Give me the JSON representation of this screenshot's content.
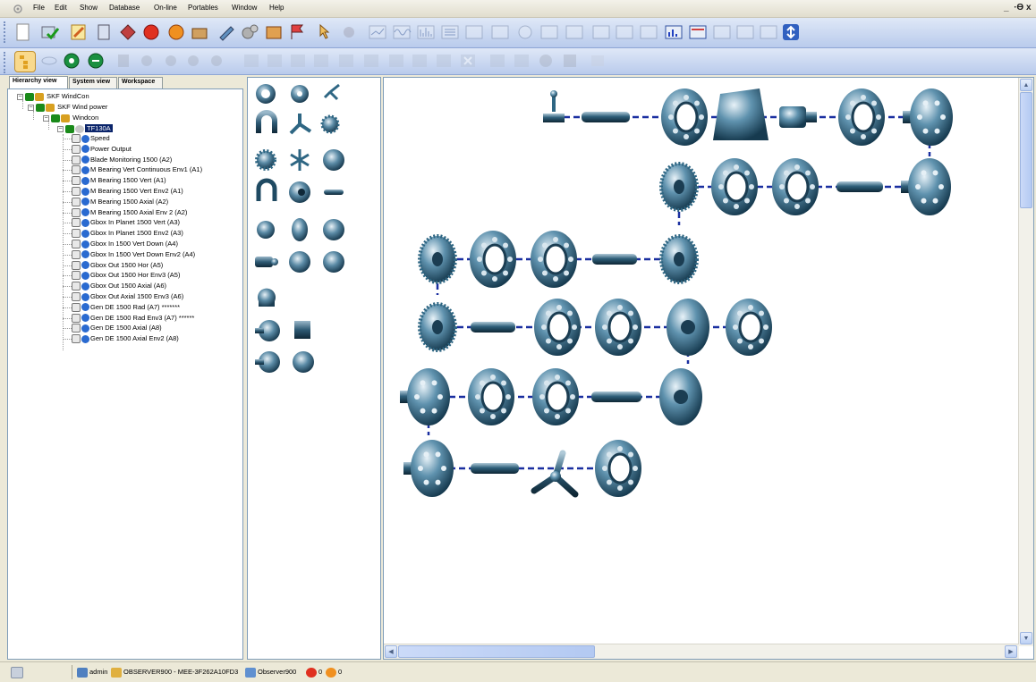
{
  "menu": {
    "items": [
      {
        "label": "File"
      },
      {
        "label": "Edit"
      },
      {
        "label": "Show"
      },
      {
        "label": "Database"
      },
      {
        "label": "On-line"
      },
      {
        "label": "Portables"
      },
      {
        "label": "Window"
      },
      {
        "label": "Help"
      }
    ]
  },
  "window_controls": {
    "minimize": "_",
    "restore": "·ϴ",
    "close": "x"
  },
  "tabs": [
    {
      "label": "Hierarchy view"
    },
    {
      "label": "System view"
    },
    {
      "label": "Workspace"
    }
  ],
  "tree": {
    "root": "SKF WindCon",
    "level1": "SKF Wind power",
    "level2": "Windcon",
    "machine": "TF130A",
    "points": [
      "Speed",
      "Power Output",
      "Blade Monitoring 1500 (A2)",
      "M Bearing Vert Continuous Env1 (A1)",
      "M Bearing 1500 Vert (A1)",
      "M Bearing 1500 Vert Env2 (A1)",
      "M Bearing 1500 Axial (A2)",
      "M Bearing 1500 Axial Env 2  (A2)",
      "Gbox In Planet 1500 Vert (A3)",
      "Gbox In Planet 1500 Env2 (A3)",
      "Gbox In 1500 Vert Down (A4)",
      "Gbox In 1500 Vert Down Env2 (A4)",
      "Gbox Out 1500 Hor (A5)",
      "Gbox Out 1500 Hor Env3 (A5)",
      "Gbox Out 1500 Axial (A6)",
      "Gbox Out Axial 1500 Env3 (A6)",
      "Gen DE 1500 Rad (A7) *******",
      "Gen DE 1500 Rad Env3 (A7) ******",
      "Gen DE 1500 Axial (A8)",
      "Gen DE 1500 Axial Env2 (A8)"
    ]
  },
  "palette": [
    "bearing",
    "bearing-small",
    "propeller-small",
    "magnet",
    "three-blade-fan",
    "gear-small",
    "spur-gear",
    "multi-blade-fan",
    "impeller",
    "u-magnet",
    "bearing-large",
    "shaft",
    "disc",
    "ribbed-disc",
    "pump-housing",
    "motor",
    "impeller-wheel",
    "flanged-hub",
    "volute",
    "coupling-hub",
    "cube-block",
    "flanged-disc",
    "fan-coupling"
  ],
  "statusbar": {
    "user": "admin",
    "server": "OBSERVER900 - MEE-3F262A10FD3",
    "database": "Observer900",
    "alarm_count": "0",
    "warning_count": "0"
  },
  "colors": {
    "component": "#2e6683",
    "connector": "#1a2fa0",
    "selection": "#0a246a"
  }
}
